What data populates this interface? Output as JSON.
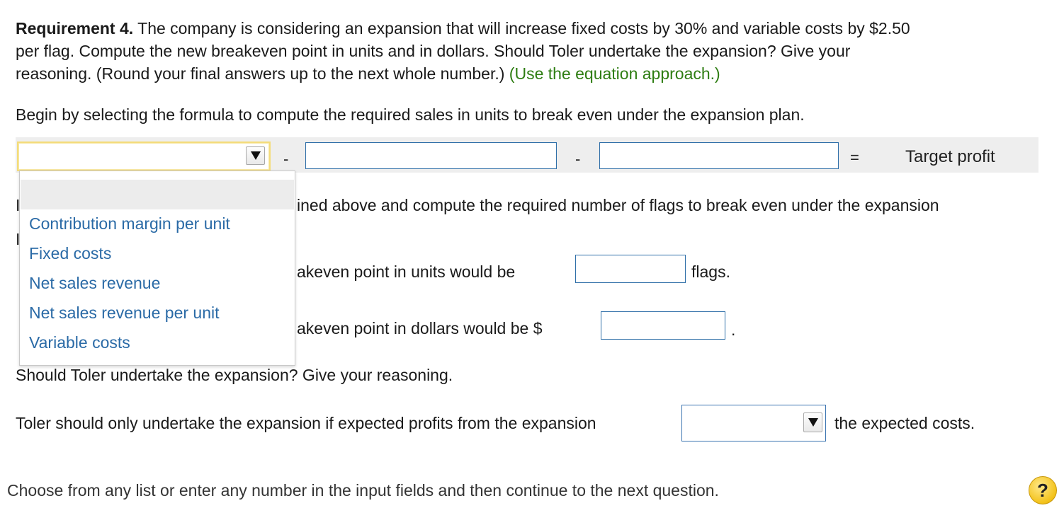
{
  "req": {
    "bold": "Requirement 4.",
    "line1": "The company is considering an expansion that will increase fixed costs by 30% and variable costs by $2.50",
    "line2": "per flag. Compute the new breakeven point in units and in dollars. Should Toler undertake the expansion? Give your",
    "line3": "reasoning. (Round your final answers up to the next whole number.)",
    "hint": "(Use the equation approach.)"
  },
  "begin_text": "Begin by selecting the formula to compute the required sales in units to break even under the expansion plan.",
  "formula": {
    "minus1": "-",
    "minus2": "-",
    "equals": "=",
    "target": "Target profit"
  },
  "dropdown": {
    "options": [
      "Contribution margin per unit",
      "Fixed costs",
      "Net sales revenue",
      "Net sales revenue per unit",
      "Variable costs"
    ]
  },
  "hidden_text": {
    "line_a_start": "I",
    "line_a_rest": "ined above and compute the required number of flags to break even under the expansion",
    "line_b_start": "I",
    "units_text": "akeven point in units would be",
    "units_suffix": "flags.",
    "dollars_text": "akeven point in dollars would be $",
    "dollars_suffix": "."
  },
  "question": "Should Toler undertake the expansion? Give your reasoning.",
  "answer": {
    "before": "Toler should only undertake the expansion if expected profits from the expansion",
    "after": "the expected costs."
  },
  "footer": "Choose from any list or enter any number in the input fields and then continue to the next question.",
  "help_label": "?"
}
